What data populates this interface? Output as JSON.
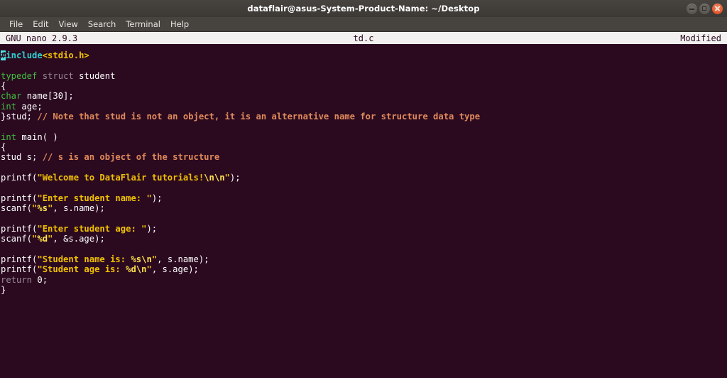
{
  "window": {
    "title": "dataflair@asus-System-Product-Name: ~/Desktop",
    "controls": {
      "minimize_label": "minimize",
      "maximize_label": "maximize",
      "close_label": "close"
    }
  },
  "menubar": {
    "items": [
      {
        "label": "File"
      },
      {
        "label": "Edit"
      },
      {
        "label": "View"
      },
      {
        "label": "Search"
      },
      {
        "label": "Terminal"
      },
      {
        "label": "Help"
      }
    ]
  },
  "nano": {
    "version": "GNU nano 2.9.3",
    "filename": "td.c",
    "status": "Modified"
  },
  "colors": {
    "terminal_background": "#2b0a20",
    "titlebar_background": "#403d3a",
    "menubar_background": "#474440",
    "statusbar_background": "#f2f1f0",
    "statusbar_text": "#2b0a20",
    "preprocessor": "#2fd0d0",
    "header_name": "#f0c000",
    "keyword": "#3fbf3f",
    "dim_keyword": "#9a8a93",
    "comment": "#e08a5a",
    "string": "#f0c000",
    "escape": "#ffe34d",
    "plain_text": "#ffffff",
    "cursor": "#4fe3e3",
    "close_button": "#e2552a"
  },
  "code": {
    "language": "c",
    "cursor_position": {
      "line": 1,
      "column": 1
    },
    "lines": [
      {
        "n": 1,
        "text": "#include<stdio.h>",
        "tokens": [
          {
            "t": "#",
            "c": "cursor"
          },
          {
            "t": "include",
            "c": "tok-pre"
          },
          {
            "t": "<stdio.h>",
            "c": "tok-header"
          }
        ]
      },
      {
        "n": 2,
        "text": "",
        "tokens": []
      },
      {
        "n": 3,
        "text": "typedef struct student",
        "tokens": [
          {
            "t": "typedef",
            "c": "tok-kw"
          },
          {
            "t": " ",
            "c": "tok-plain"
          },
          {
            "t": "struct",
            "c": "tok-dim"
          },
          {
            "t": " student",
            "c": "tok-plain"
          }
        ]
      },
      {
        "n": 4,
        "text": "{",
        "tokens": [
          {
            "t": "{",
            "c": "tok-plain"
          }
        ]
      },
      {
        "n": 5,
        "text": "char name[30];",
        "tokens": [
          {
            "t": "char",
            "c": "tok-kw"
          },
          {
            "t": " name[30];",
            "c": "tok-plain"
          }
        ]
      },
      {
        "n": 6,
        "text": "int age;",
        "tokens": [
          {
            "t": "int",
            "c": "tok-kw"
          },
          {
            "t": " age;",
            "c": "tok-plain"
          }
        ]
      },
      {
        "n": 7,
        "text": "}stud; // Note that stud is not an object, it is an alternative name for structure data type",
        "tokens": [
          {
            "t": "}stud; ",
            "c": "tok-plain"
          },
          {
            "t": "// Note that stud is not an object, it is an alternative name for structure data type",
            "c": "tok-comment"
          }
        ]
      },
      {
        "n": 8,
        "text": "",
        "tokens": []
      },
      {
        "n": 9,
        "text": "int main( )",
        "tokens": [
          {
            "t": "int",
            "c": "tok-kw"
          },
          {
            "t": " main( )",
            "c": "tok-plain"
          }
        ]
      },
      {
        "n": 10,
        "text": "{",
        "tokens": [
          {
            "t": "{",
            "c": "tok-plain"
          }
        ]
      },
      {
        "n": 11,
        "text": "stud s; // s is an object of the structure",
        "tokens": [
          {
            "t": "stud s; ",
            "c": "tok-plain"
          },
          {
            "t": "// s is an object of the structure",
            "c": "tok-comment"
          }
        ]
      },
      {
        "n": 12,
        "text": "",
        "tokens": []
      },
      {
        "n": 13,
        "text": "printf(\"Welcome to DataFlair tutorials!\\n\\n\");",
        "tokens": [
          {
            "t": "printf(",
            "c": "tok-plain"
          },
          {
            "t": "\"Welcome to DataFlair tutorials!",
            "c": "tok-str"
          },
          {
            "t": "\\n\\n",
            "c": "tok-esc"
          },
          {
            "t": "\"",
            "c": "tok-str"
          },
          {
            "t": ");",
            "c": "tok-plain"
          }
        ]
      },
      {
        "n": 14,
        "text": "",
        "tokens": []
      },
      {
        "n": 15,
        "text": "printf(\"Enter student name: \");",
        "tokens": [
          {
            "t": "printf(",
            "c": "tok-plain"
          },
          {
            "t": "\"Enter student name: \"",
            "c": "tok-str"
          },
          {
            "t": ");",
            "c": "tok-plain"
          }
        ]
      },
      {
        "n": 16,
        "text": "scanf(\"%s\", s.name);",
        "tokens": [
          {
            "t": "scanf(",
            "c": "tok-plain"
          },
          {
            "t": "\"",
            "c": "tok-str"
          },
          {
            "t": "%s",
            "c": "tok-esc"
          },
          {
            "t": "\"",
            "c": "tok-str"
          },
          {
            "t": ", s.name);",
            "c": "tok-plain"
          }
        ]
      },
      {
        "n": 17,
        "text": "",
        "tokens": []
      },
      {
        "n": 18,
        "text": "printf(\"Enter student age: \");",
        "tokens": [
          {
            "t": "printf(",
            "c": "tok-plain"
          },
          {
            "t": "\"Enter student age: \"",
            "c": "tok-str"
          },
          {
            "t": ");",
            "c": "tok-plain"
          }
        ]
      },
      {
        "n": 19,
        "text": "scanf(\"%d\", &s.age);",
        "tokens": [
          {
            "t": "scanf(",
            "c": "tok-plain"
          },
          {
            "t": "\"",
            "c": "tok-str"
          },
          {
            "t": "%d",
            "c": "tok-esc"
          },
          {
            "t": "\"",
            "c": "tok-str"
          },
          {
            "t": ", &s.age);",
            "c": "tok-plain"
          }
        ]
      },
      {
        "n": 20,
        "text": "",
        "tokens": []
      },
      {
        "n": 21,
        "text": "printf(\"Student name is: %s\\n\", s.name);",
        "tokens": [
          {
            "t": "printf(",
            "c": "tok-plain"
          },
          {
            "t": "\"Student name is: ",
            "c": "tok-str"
          },
          {
            "t": "%s\\n",
            "c": "tok-esc"
          },
          {
            "t": "\"",
            "c": "tok-str"
          },
          {
            "t": ", s.name);",
            "c": "tok-plain"
          }
        ]
      },
      {
        "n": 22,
        "text": "printf(\"Student age is: %d\\n\", s.age);",
        "tokens": [
          {
            "t": "printf(",
            "c": "tok-plain"
          },
          {
            "t": "\"Student age is: ",
            "c": "tok-str"
          },
          {
            "t": "%d\\n",
            "c": "tok-esc"
          },
          {
            "t": "\"",
            "c": "tok-str"
          },
          {
            "t": ", s.age);",
            "c": "tok-plain"
          }
        ]
      },
      {
        "n": 23,
        "text": "return 0;",
        "tokens": [
          {
            "t": "return",
            "c": "tok-dim"
          },
          {
            "t": " 0;",
            "c": "tok-plain"
          }
        ]
      },
      {
        "n": 24,
        "text": "}",
        "tokens": [
          {
            "t": "}",
            "c": "tok-plain"
          }
        ]
      }
    ]
  }
}
